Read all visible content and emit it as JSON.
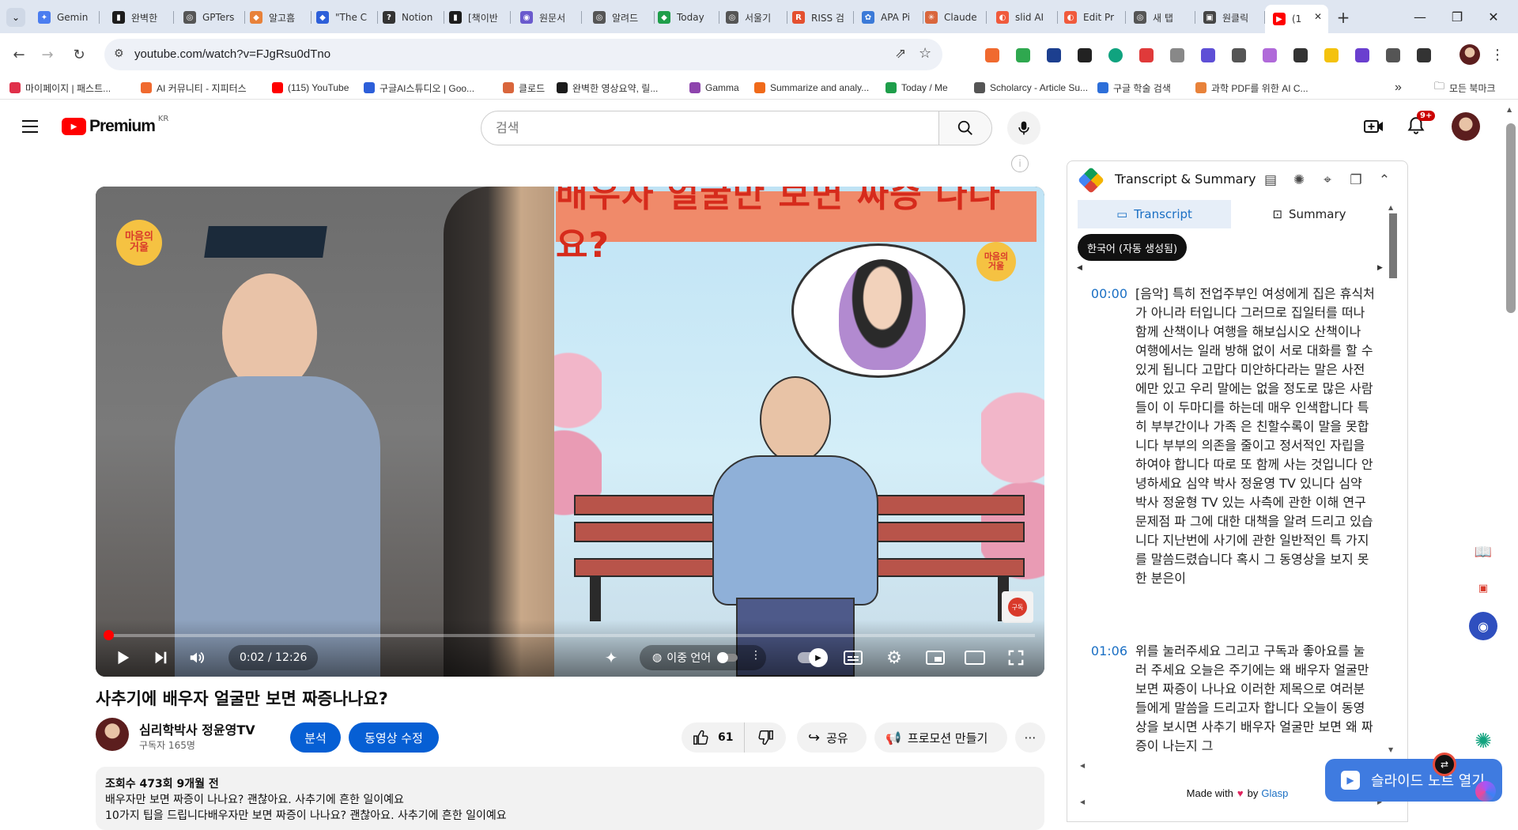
{
  "tabs": [
    {
      "label": "Gemin",
      "color": "#4a7df0",
      "glyph": "✦"
    },
    {
      "label": "완벽한",
      "color": "#1c1c1c",
      "glyph": "▮"
    },
    {
      "label": "GPTers",
      "color": "#555555",
      "glyph": "◎"
    },
    {
      "label": "알고흠",
      "color": "#e8823a",
      "glyph": "◆"
    },
    {
      "label": "\"The C",
      "color": "#2d5fd9",
      "glyph": "◆"
    },
    {
      "label": "Notion",
      "color": "#333333",
      "glyph": "?"
    },
    {
      "label": "[책이반",
      "color": "#1c1c1c",
      "glyph": "▮"
    },
    {
      "label": "원문서",
      "color": "#6a5acd",
      "glyph": "◉"
    },
    {
      "label": "알려드",
      "color": "#555555",
      "glyph": "◎"
    },
    {
      "label": "Today",
      "color": "#1e9e4a",
      "glyph": "◆"
    },
    {
      "label": "서울기",
      "color": "#555555",
      "glyph": "◎"
    },
    {
      "label": "RISS 검",
      "color": "#e4502f",
      "glyph": "R"
    },
    {
      "label": "APA Pi",
      "color": "#3b7ad8",
      "glyph": "✿"
    },
    {
      "label": "Claude",
      "color": "#d9663c",
      "glyph": "✳"
    },
    {
      "label": "slid AI",
      "color": "#f05a3c",
      "glyph": "◐"
    },
    {
      "label": "Edit Pr",
      "color": "#f05a3c",
      "glyph": "◐"
    },
    {
      "label": "새 탭",
      "color": "#555555",
      "glyph": "◎"
    },
    {
      "label": "원클릭",
      "color": "#444444",
      "glyph": "▣"
    },
    {
      "label": "(1",
      "color": "#ff0000",
      "glyph": "▶"
    }
  ],
  "address_bar": {
    "url": "youtube.com/watch?v=FJgRsu0dTno"
  },
  "bookmarks": [
    {
      "label": "마이페이지 | 패스트...",
      "color": "#e0304a"
    },
    {
      "label": "AI 커뮤니티 - 지피터스",
      "color": "#f06a2f"
    },
    {
      "label": "(115) YouTube",
      "color": "#ff0000"
    },
    {
      "label": "구글AI스튜디오 | Goo...",
      "color": "#2d5fd9"
    },
    {
      "label": "클로드",
      "color": "#d9663c"
    },
    {
      "label": "완벽한 영상요약, 릴...",
      "color": "#1c1c1c"
    },
    {
      "label": "Gamma",
      "color": "#8e44ad"
    },
    {
      "label": "Summarize and analy...",
      "color": "#f06a1a"
    },
    {
      "label": "Today / Me",
      "color": "#1e9e4a"
    },
    {
      "label": "Scholarcy - Article Su...",
      "color": "#555555"
    },
    {
      "label": "구글 학술 검색",
      "color": "#2d6fd9"
    },
    {
      "label": "과학 PDF를 위한 AI C...",
      "color": "#e8823a"
    }
  ],
  "bookmarks_overflow": "»",
  "all_bookmarks_label": "모든 북마크",
  "youtube": {
    "logo_text": "Premium",
    "region": "KR",
    "search_placeholder": "검색",
    "notifications": "9+"
  },
  "player": {
    "banner_text": "배우자 얼굴만 보면 짜증 나나요?",
    "logo_badge": "마음의\n거울",
    "current_time": "0:02 / 12:26",
    "progress_fraction": 0.003,
    "dual_language_label": "이중 언어",
    "subscribe_badge": "구독"
  },
  "video": {
    "title": "사추기에 배우자 얼굴만 보면 짜증나나요?",
    "channel_name": "심리학박사 정윤영TV",
    "subscribers": "구독자 165명",
    "analyze_label": "분석",
    "edit_label": "동영상 수정",
    "likes": "61",
    "share_label": "공유",
    "promo_label": "프로모션 만들기",
    "more_label": "⋯"
  },
  "description": {
    "meta": "조회수 473회  9개월 전",
    "line1": "배우자만 보면 짜증이 나나요? 괜찮아요. 사추기에 흔한 일이예요",
    "line2": "10가지 팁을 드립니다배우자만 보면 짜증이 나나요? 괜찮아요. 사추기에 흔한 일이예요"
  },
  "transcript_panel": {
    "title": "Transcript & Summary",
    "tab_transcript": "Transcript",
    "tab_summary": "Summary",
    "language": "한국어 (자동 생성됨)",
    "segments": [
      {
        "time": "00:00",
        "text": "[음악] 특히 전업주부인 여성에게 집은 휴식처가 아니라 터입니다 그러므로 집일터를 떠나 함께 산책이나 여행을 해보십시오 산책이나 여행에서는 일래 방해 없이 서로 대화를 할 수 있게 됩니다 고맙다 미안하다라는 말은 사전에만 있고 우리 말에는 없을 정도로 많은 사람들이 이 두마디를 하는데 매우 인색합니다 특히 부부간이나 가족 은 친할수록이 말을 못합니다 부부의 의존을 줄이고 정서적인 자립을 하여야 합니다 따로 또 함께 사는 것입니다 안녕하세요 심약 박사 정윤영 TV 있니다 심약 박사 정윤형 TV 있는 사측에 관한 이해 연구 문제점 파 그에 대한 대책을 알려 드리고 있습니다 지난번에 사기에 관한 일반적인 특 가지를 말씀드렸습니다 혹시 그 동영상을 보지 못한 분은이"
      },
      {
        "time": "01:06",
        "text": "위를 눌러주세요 그리고 구독과 좋아요를 눌러 주세요 오늘은 주기에는 왜 배우자 얼굴만 보면 짜증이 나나요 이러한 제목으로 여러분들에게 말씀을 드리고자 합니다 오늘이 동영상을 보시면 사추기 배우자 얼굴만 보면 왜 짜증이 나는지 그"
      }
    ],
    "footer_made_with": "Made with",
    "footer_by": "by",
    "footer_brand": "Glasp"
  },
  "floating": {
    "slide_note_label": "슬라이드 노트 열기"
  }
}
